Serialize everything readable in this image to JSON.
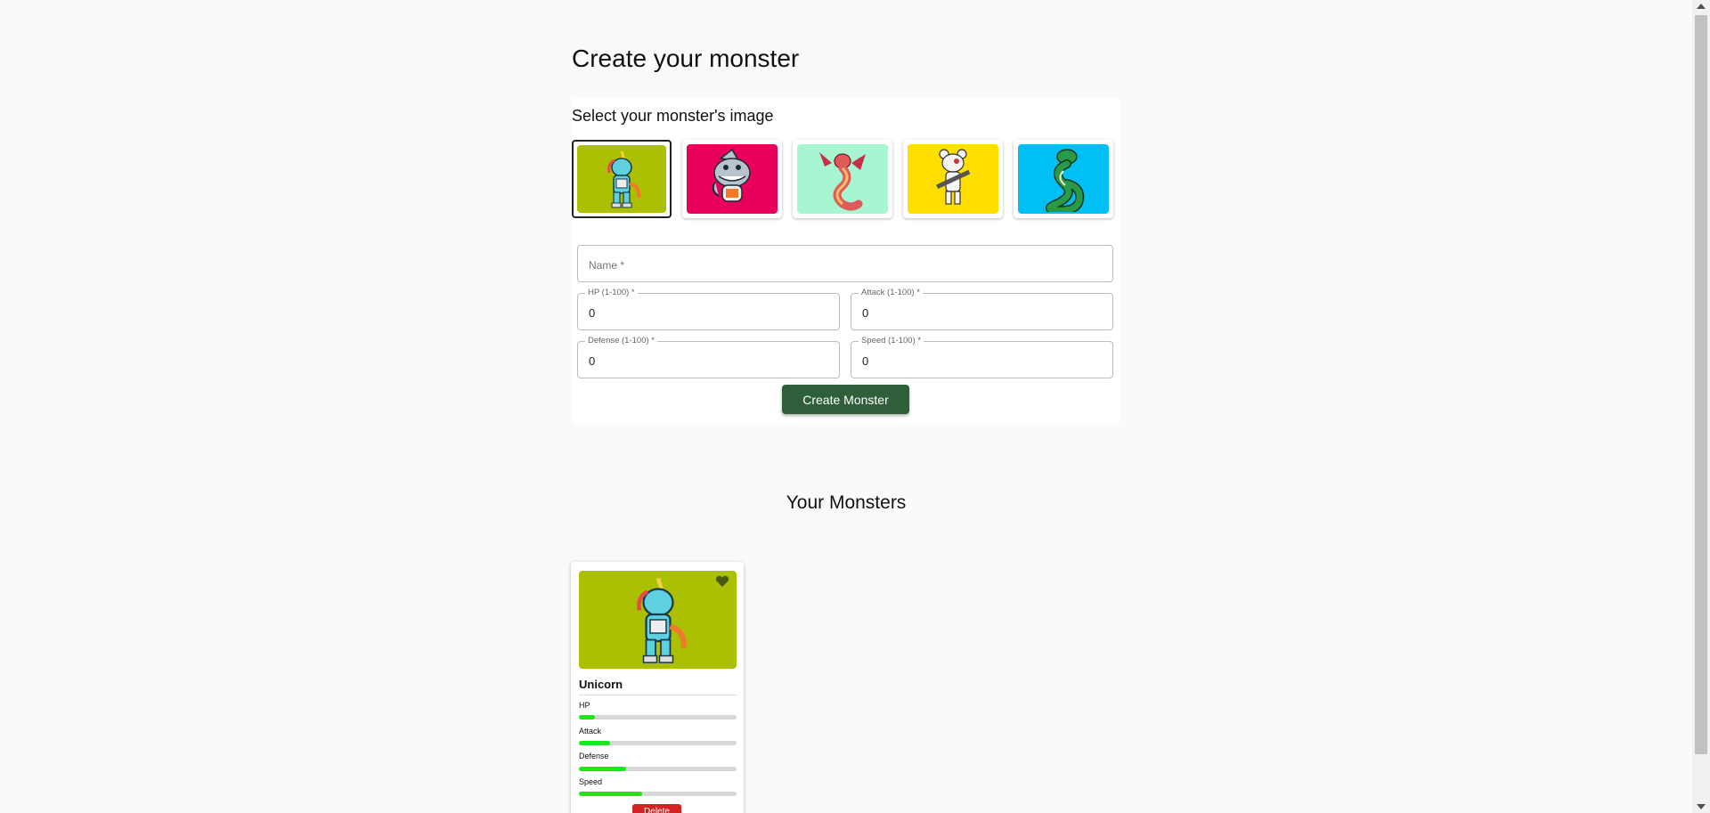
{
  "form": {
    "title": "Create your monster",
    "image_section_title": "Select your monster's image",
    "images": [
      {
        "name": "unicorn",
        "bg": "#abc000",
        "selected": true
      },
      {
        "name": "shark",
        "bg": "#e8005a",
        "selected": false
      },
      {
        "name": "dragon",
        "bg": "#a8f5d2",
        "selected": false
      },
      {
        "name": "bear",
        "bg": "#ffde00",
        "selected": false
      },
      {
        "name": "snake",
        "bg": "#00bff5",
        "selected": false
      }
    ],
    "name_placeholder": "Name *",
    "hp_label": "HP (1-100) *",
    "hp_value": "0",
    "attack_label": "Attack (1-100) *",
    "attack_value": "0",
    "defense_label": "Defense (1-100) *",
    "defense_value": "0",
    "speed_label": "Speed (1-100) *",
    "speed_value": "0",
    "create_button": "Create Monster",
    "create_button_color": "#2e5e3a"
  },
  "monsters_section": {
    "title": "Your Monsters",
    "cards": [
      {
        "name": "Unicorn",
        "image_bg": "#abc000",
        "favorite_icon": "heart-icon",
        "stats": [
          {
            "label": "HP",
            "fraction": 0.1
          },
          {
            "label": "Attack",
            "fraction": 0.2
          },
          {
            "label": "Defense",
            "fraction": 0.3
          },
          {
            "label": "Speed",
            "fraction": 0.4
          }
        ],
        "delete_button": "Delete",
        "delete_button_color": "#d32222"
      }
    ]
  },
  "colors": {
    "bar_fill": "#1ee61e",
    "bar_track": "#d7d7d7"
  }
}
